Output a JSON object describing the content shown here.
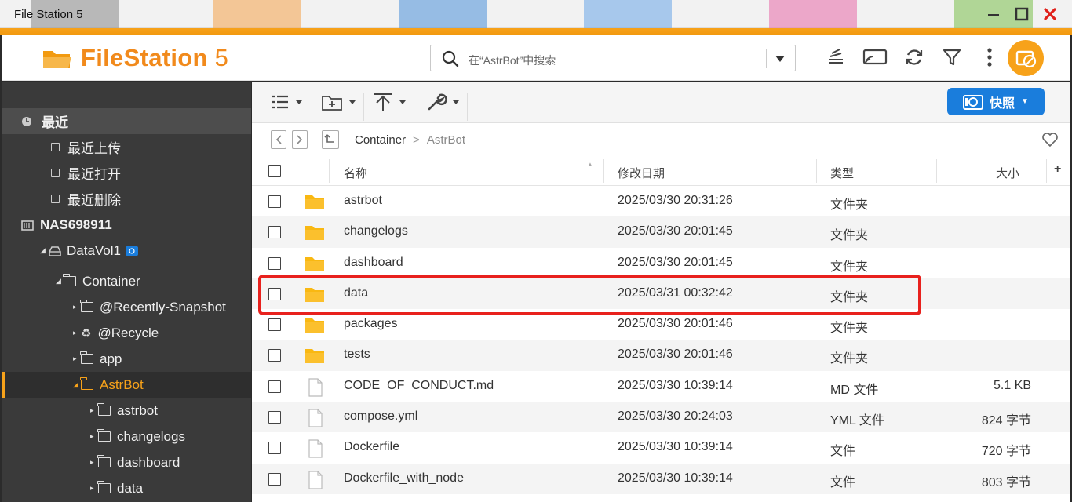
{
  "window": {
    "title": "File Station 5",
    "controls": [
      "minimize",
      "maximize",
      "close"
    ],
    "accent_color": "#f7a21a",
    "close_color": "#e0201a"
  },
  "header": {
    "logo_brand": "FileStation",
    "logo_version": " 5",
    "search_placeholder": "在“AstrBot”中搜索",
    "icons": [
      "stack-icon",
      "cast-icon",
      "refresh-icon",
      "filter-icon",
      "more-icon",
      "hub-icon"
    ]
  },
  "toolbar": {
    "snapshot_label": "快照",
    "snapshot_color": "#1a7ddc"
  },
  "breadcrumb": {
    "parent": "Container",
    "separator": ">",
    "current": "AstrBot"
  },
  "columns": {
    "name": "名称",
    "modified": "修改日期",
    "type": "类型",
    "size": "大小"
  },
  "sidebar": {
    "recent": "最近",
    "recent_upload": "最近上传",
    "recent_open": "最近打开",
    "recent_delete": "最近删除",
    "nas": "NAS698911",
    "volume": "DataVol1",
    "container": "Container",
    "snapshot_folder": "@Recently-Snapshot",
    "recycle": "@Recycle",
    "app": "app",
    "astrbot_root": "AstrBot",
    "sub_astrbot": "astrbot",
    "sub_changelogs": "changelogs",
    "sub_dashboard": "dashboard",
    "sub_data": "data"
  },
  "files": [
    {
      "name": "astrbot",
      "modified": "2025/03/30 20:31:26",
      "type": "文件夹",
      "size": "",
      "kind": "folder"
    },
    {
      "name": "changelogs",
      "modified": "2025/03/30 20:01:45",
      "type": "文件夹",
      "size": "",
      "kind": "folder"
    },
    {
      "name": "dashboard",
      "modified": "2025/03/30 20:01:45",
      "type": "文件夹",
      "size": "",
      "kind": "folder"
    },
    {
      "name": "data",
      "modified": "2025/03/31 00:32:42",
      "type": "文件夹",
      "size": "",
      "kind": "folder"
    },
    {
      "name": "packages",
      "modified": "2025/03/30 20:01:46",
      "type": "文件夹",
      "size": "",
      "kind": "folder"
    },
    {
      "name": "tests",
      "modified": "2025/03/30 20:01:46",
      "type": "文件夹",
      "size": "",
      "kind": "folder"
    },
    {
      "name": "CODE_OF_CONDUCT.md",
      "modified": "2025/03/30 10:39:14",
      "type": "MD 文件",
      "size": "5.1 KB",
      "kind": "file"
    },
    {
      "name": "compose.yml",
      "modified": "2025/03/30 20:24:03",
      "type": "YML 文件",
      "size": "824 字节",
      "kind": "file"
    },
    {
      "name": "Dockerfile",
      "modified": "2025/03/30 10:39:14",
      "type": "文件",
      "size": "720 字节",
      "kind": "file"
    },
    {
      "name": "Dockerfile_with_node",
      "modified": "2025/03/30 10:39:14",
      "type": "文件",
      "size": "803 字节",
      "kind": "file"
    }
  ],
  "highlighted_row": "data",
  "highlight_color": "#e8211d"
}
